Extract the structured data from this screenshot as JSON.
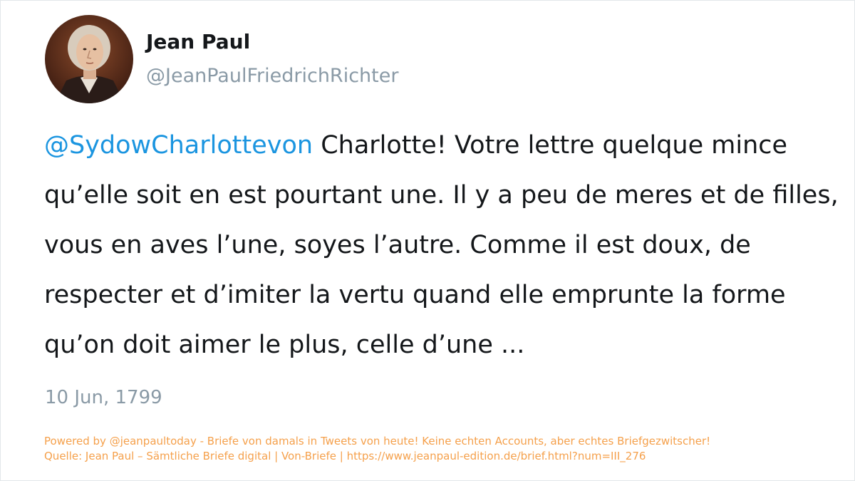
{
  "profile": {
    "name": "Jean Paul",
    "handle": "@JeanPaulFriedrichRichter",
    "avatar_icon": "portrait-avatar"
  },
  "tweet": {
    "mention": "@SydowCharlottevon",
    "text": " Charlotte! Votre lettre quelque mince qu’elle soit en est pourtant une. Il y a peu de meres et de filles, vous en aves l’une, soyes l’autre. Comme il est doux, de respecter et d’imiter la vertu quand elle emprunte la forme qu’on doit aimer le plus, celle d’une ...",
    "date": "10 Jun, 1799"
  },
  "footer": {
    "line1": "Powered by @jeanpaultoday - Briefe von damals in Tweets von heute! Keine echten Accounts, aber echtes Briefgezwitscher!",
    "line2": "Quelle: Jean Paul – Sämtliche Briefe digital | Von-Briefe | https://www.jeanpaul-edition.de/brief.html?num=III_276"
  },
  "colors": {
    "mention": "#1b95e0",
    "text": "#14171a",
    "muted": "#8a9aa6",
    "footer": "#f5a04b"
  }
}
